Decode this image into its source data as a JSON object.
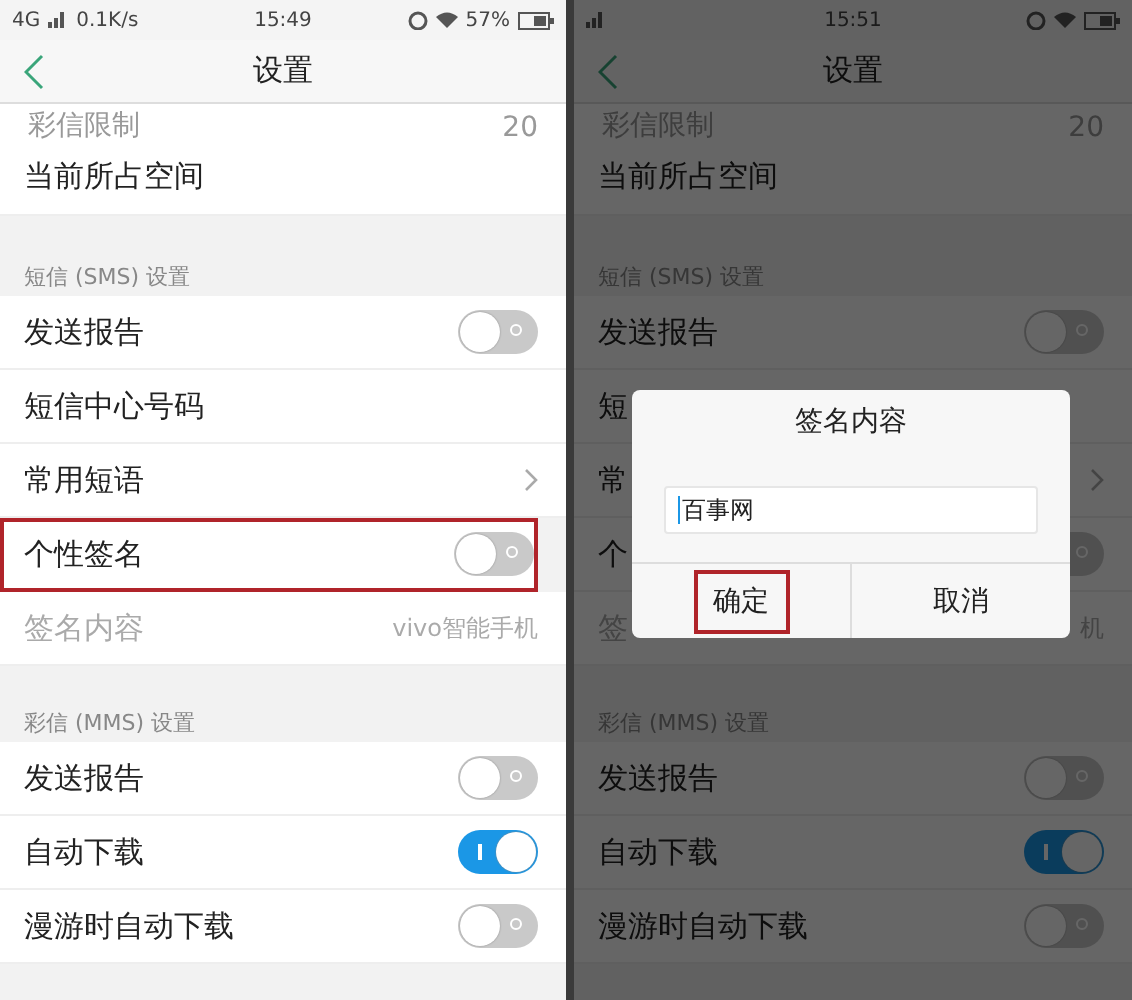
{
  "screens": [
    {
      "dimmed": false,
      "status_bar": {
        "network": "4G",
        "speed": "0.1K/s",
        "time": "15:49",
        "battery": "57%"
      },
      "header": {
        "title": "设置"
      },
      "partial_row": {
        "label": "彩信限制",
        "value": "20"
      },
      "rows": [
        {
          "kind": "plain",
          "label": "当前所占空间"
        }
      ],
      "sections": [
        {
          "title": "短信 (SMS) 设置",
          "rows": [
            {
              "kind": "toggle",
              "label": "发送报告",
              "on": false,
              "highlighted": false
            },
            {
              "kind": "plain",
              "label": "短信中心号码",
              "highlighted": false
            },
            {
              "kind": "link",
              "label": "常用短语",
              "highlighted": false
            },
            {
              "kind": "toggle",
              "label": "个性签名",
              "on": false,
              "highlighted": true
            },
            {
              "kind": "value",
              "label": "签名内容",
              "value": "vivo智能手机",
              "disabled": true,
              "highlighted": false
            }
          ]
        },
        {
          "title": "彩信 (MMS) 设置",
          "rows": [
            {
              "kind": "toggle",
              "label": "发送报告",
              "on": false,
              "highlighted": false
            },
            {
              "kind": "toggle",
              "label": "自动下载",
              "on": true,
              "highlighted": false
            },
            {
              "kind": "toggle",
              "label": "漫游时自动下载",
              "on": false,
              "highlighted": false
            }
          ]
        }
      ]
    },
    {
      "dimmed": true,
      "status_bar": {
        "time": "15:51"
      },
      "header": {
        "title": "设置"
      },
      "partial_row": {
        "label": "彩信限制",
        "value": "20"
      },
      "rows": [
        {
          "kind": "plain",
          "label": "当前所占空间"
        }
      ],
      "sections": [
        {
          "title": "短信 (SMS) 设置",
          "rows": [
            {
              "kind": "toggle",
              "label": "发送报告",
              "on": false,
              "highlighted": false
            },
            {
              "kind": "plain",
              "label": "短",
              "highlighted": false
            },
            {
              "kind": "link",
              "label": "常",
              "highlighted": false
            },
            {
              "kind": "toggle",
              "label": "个",
              "on": false,
              "highlighted": false
            },
            {
              "kind": "value",
              "label": "签",
              "value": "机",
              "disabled": true,
              "highlighted": false
            }
          ]
        },
        {
          "title": "彩信 (MMS) 设置",
          "rows": [
            {
              "kind": "toggle",
              "label": "发送报告",
              "on": false,
              "highlighted": false
            },
            {
              "kind": "toggle",
              "label": "自动下载",
              "on": true,
              "highlighted": false
            },
            {
              "kind": "toggle",
              "label": "漫游时自动下载",
              "on": false,
              "highlighted": false
            }
          ]
        }
      ],
      "dialog": {
        "title": "签名内容",
        "value": "百事网",
        "buttons": [
          {
            "label": "确定",
            "highlighted": true
          },
          {
            "label": "取消",
            "highlighted": false
          }
        ]
      }
    }
  ]
}
